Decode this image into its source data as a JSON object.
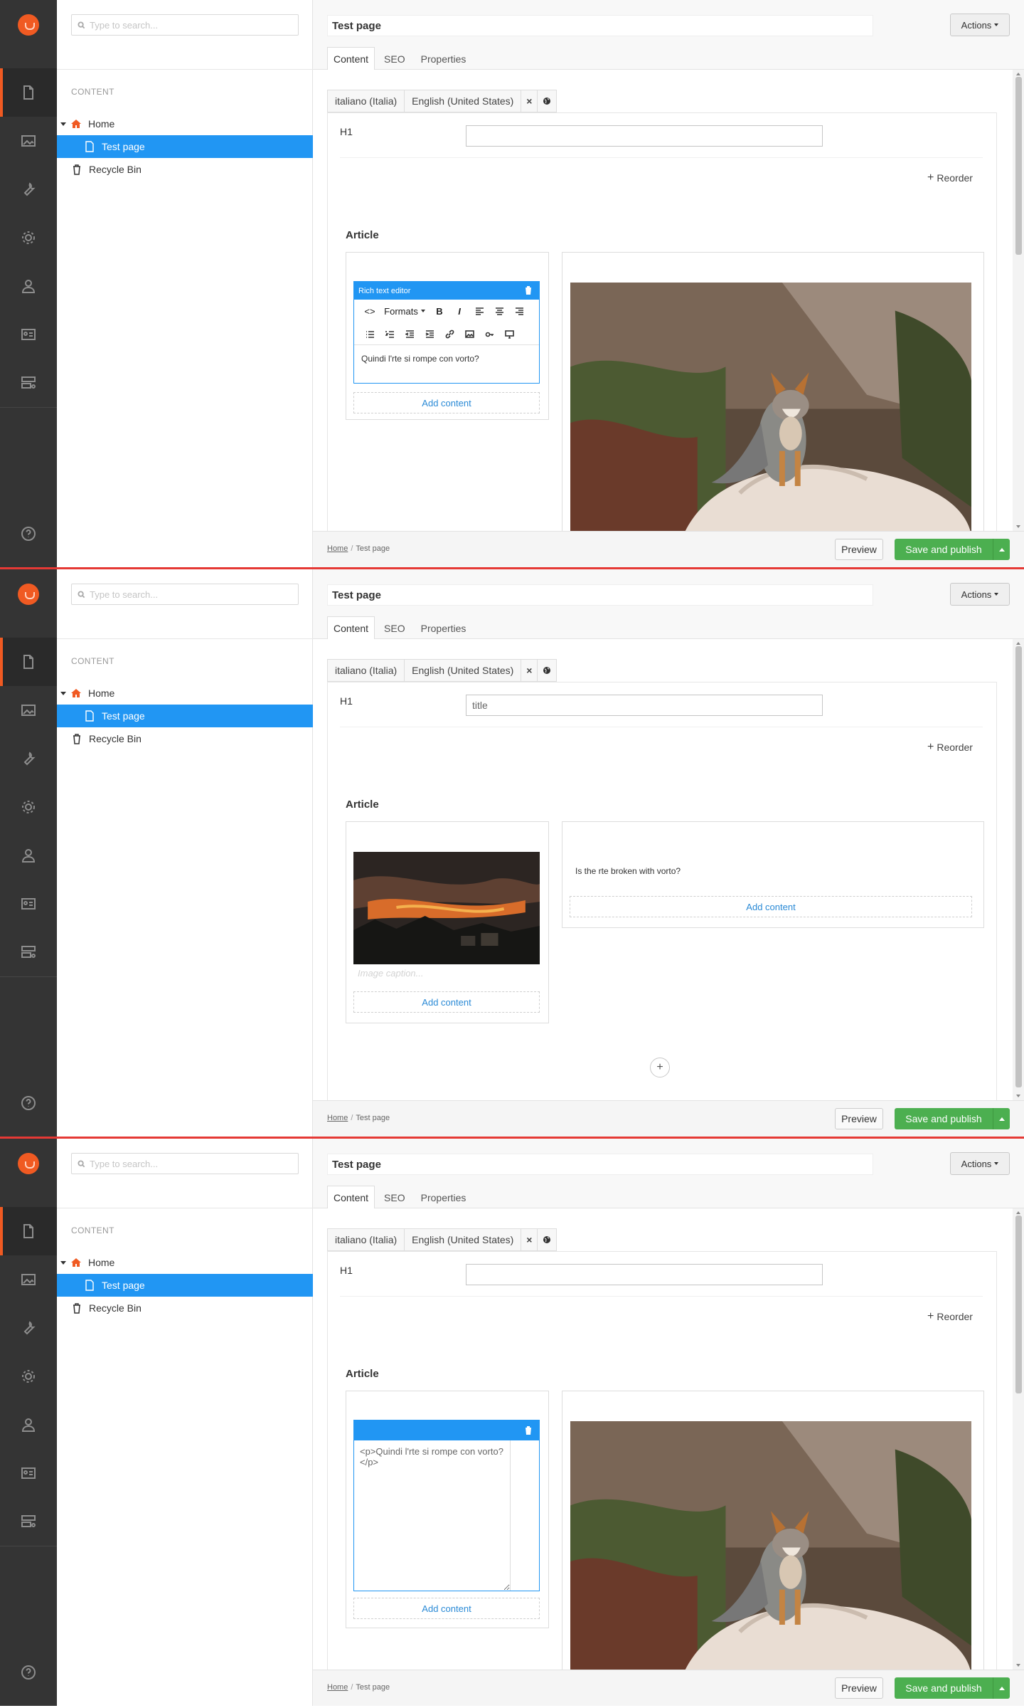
{
  "search": {
    "placeholder": "Type to search..."
  },
  "tree": {
    "section": "CONTENT",
    "items": [
      {
        "label": "Home",
        "icon": "home-icon"
      },
      {
        "label": "Test page",
        "icon": "page-icon"
      },
      {
        "label": "Recycle Bin",
        "icon": "trash-icon"
      }
    ]
  },
  "iconbar": [
    "content-icon",
    "media-icon",
    "developer-icon",
    "settings-icon",
    "users-icon",
    "members-icon",
    "forms-icon",
    "help-icon"
  ],
  "header": {
    "page_name": "Test page",
    "actions": "Actions",
    "tabs": [
      "Content",
      "SEO",
      "Properties"
    ]
  },
  "languages": [
    "italiano (Italia)",
    "English (United States)"
  ],
  "lang_close": "×",
  "h1_label": "H1",
  "reorder": "Reorder",
  "article": "Article",
  "add_content": "Add content",
  "rte": {
    "title": "Rich text editor",
    "formats": "Formats",
    "bold": "B",
    "italic": "I",
    "text_it": "Quindi l'rte si rompe con vorto?"
  },
  "panels": [
    {
      "h1_value": "",
      "state": "rte-editor"
    },
    {
      "h1_value": "title",
      "state": "image-and-text",
      "text_en": "Is the rte broken with vorto?",
      "image_caption_placeholder": "Image caption..."
    },
    {
      "h1_value": "",
      "state": "raw-source",
      "raw_text": "<p>Quindi l'rte si rompe con vorto?</p>"
    }
  ],
  "footer": {
    "breadcrumb": [
      "Home",
      "Test page"
    ],
    "preview": "Preview",
    "save_publish": "Save and publish"
  },
  "colors": {
    "accent": "#2196f3",
    "brand": "#f05a22",
    "publish": "#4caf50",
    "iconbar": "#343434",
    "divider": "#e53935"
  }
}
